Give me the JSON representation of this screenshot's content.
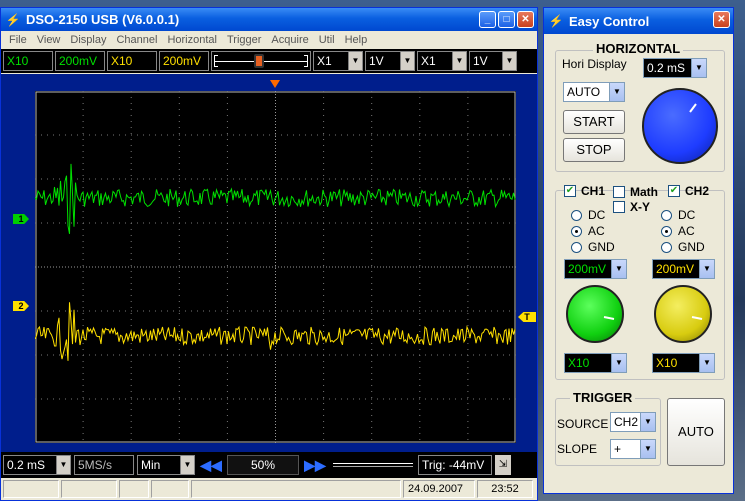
{
  "main_window": {
    "title": "DSO-2150 USB (V6.0.0.1)",
    "menu": [
      "File",
      "View",
      "Display",
      "Channel",
      "Horizontal",
      "Trigger",
      "Acquire",
      "Util",
      "Help"
    ],
    "toolbar": {
      "ch1_probe": "X10",
      "ch1_volts": "200mV",
      "ch2_probe": "X10",
      "ch2_volts": "200mV",
      "combo5": "X1",
      "combo6": "1V",
      "combo7": "X1",
      "combo8": "1V"
    },
    "bottom": {
      "time_div": "0.2 mS",
      "sample_rate": "5MS/s",
      "mode": "Min",
      "position_pct": "50%",
      "trig_readout": "Trig: -44mV"
    },
    "status": {
      "date": "24.09.2007",
      "time": "23:52"
    },
    "markers": {
      "ch1": "1",
      "ch2": "2",
      "trig": "T"
    }
  },
  "easy_control": {
    "title": "Easy Control",
    "horizontal": {
      "title": "HORIZONTAL",
      "hori_display_label": "Hori Display",
      "time_div": "0.2 mS",
      "mode": "AUTO",
      "start": "START",
      "stop": "STOP"
    },
    "channels": {
      "ch1_label": "CH1",
      "math_label": "Math",
      "xy_label": "X-Y",
      "ch2_label": "CH2",
      "ch1_checked": true,
      "ch2_checked": true,
      "coupling_options": [
        "DC",
        "AC",
        "GND"
      ],
      "ch1_coupling": "AC",
      "ch2_coupling": "AC",
      "ch1_volts": "200mV",
      "ch2_volts": "200mV",
      "ch1_probe": "X10",
      "ch2_probe": "X10"
    },
    "trigger": {
      "title": "TRIGGER",
      "source_label": "SOURCE",
      "source": "CH2",
      "slope_label": "SLOPE",
      "slope": "+",
      "auto": "AUTO"
    }
  },
  "colors": {
    "ch1": "#00e000",
    "ch2": "#ffe000",
    "horizontal_knob": "#1e3cff",
    "title_blue": "#0a5fe0"
  }
}
